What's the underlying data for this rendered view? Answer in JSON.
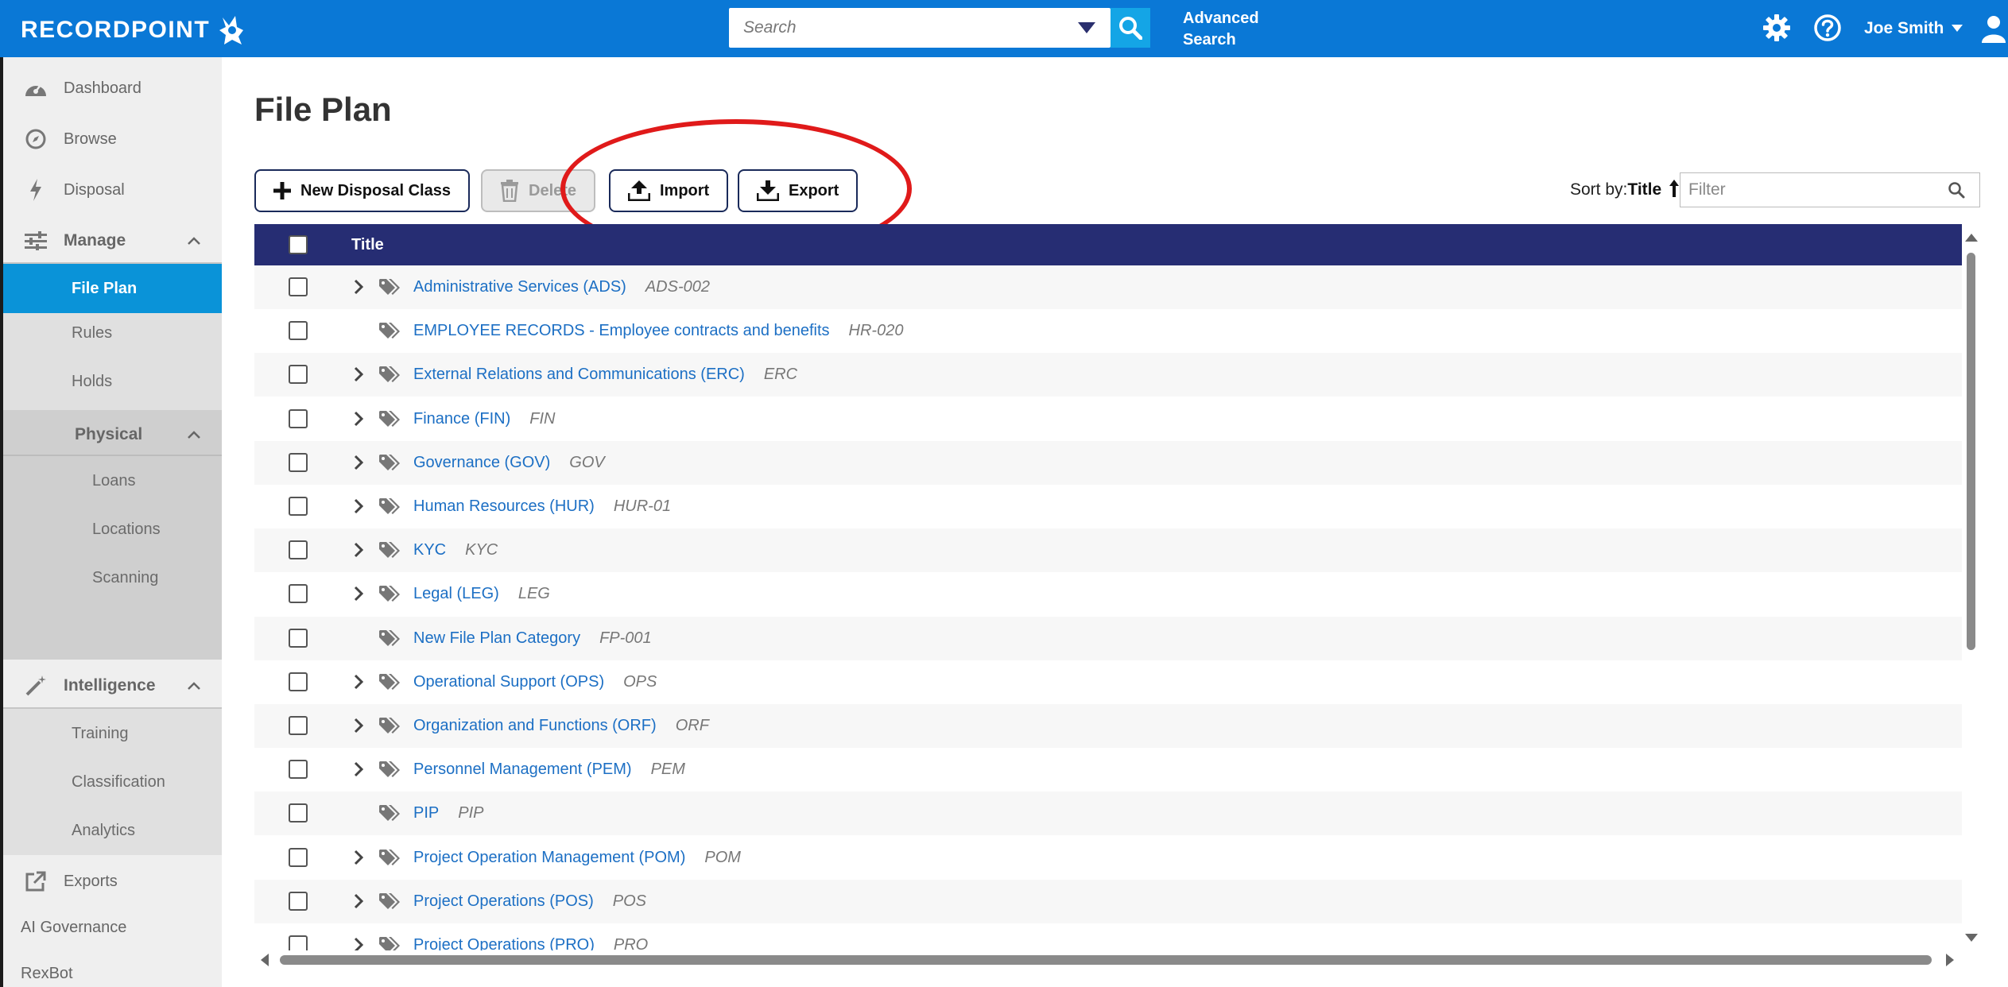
{
  "header": {
    "logo_text": "RECORDPOINT",
    "search_placeholder": "Search",
    "advanced_search_line1": "Advanced",
    "advanced_search_line2": "Search",
    "user_name": "Joe Smith",
    "bg_color": "#0a78d6"
  },
  "sidebar": {
    "dashboard": "Dashboard",
    "browse": "Browse",
    "disposal": "Disposal",
    "manage": "Manage",
    "file_plan": "File Plan",
    "rules": "Rules",
    "holds": "Holds",
    "physical": "Physical",
    "loans": "Loans",
    "locations": "Locations",
    "scanning": "Scanning",
    "intelligence": "Intelligence",
    "training": "Training",
    "classification": "Classification",
    "analytics": "Analytics",
    "exports": "Exports",
    "ai_governance": "AI Governance",
    "rexbot": "RexBot"
  },
  "main": {
    "title": "File Plan",
    "buttons": {
      "new_disposal_class": "New Disposal Class",
      "delete": "Delete",
      "import": "Import",
      "export": "Export"
    },
    "sort_label": "Sort by:",
    "sort_field": "Title",
    "filter_placeholder": "Filter",
    "table_header_title": "Title"
  },
  "rows": [
    {
      "name": "Administrative Services (ADS)",
      "code": "ADS-002",
      "expandable": true
    },
    {
      "name": "EMPLOYEE RECORDS - Employee contracts and benefits",
      "code": "HR-020",
      "expandable": false
    },
    {
      "name": "External Relations and Communications (ERC)",
      "code": "ERC",
      "expandable": true
    },
    {
      "name": "Finance (FIN)",
      "code": "FIN",
      "expandable": true
    },
    {
      "name": "Governance (GOV)",
      "code": "GOV",
      "expandable": true
    },
    {
      "name": "Human Resources (HUR)",
      "code": "HUR-01",
      "expandable": true
    },
    {
      "name": "KYC",
      "code": "KYC",
      "expandable": true
    },
    {
      "name": "Legal (LEG)",
      "code": "LEG",
      "expandable": true
    },
    {
      "name": "New File Plan Category",
      "code": "FP-001",
      "expandable": false
    },
    {
      "name": "Operational Support (OPS)",
      "code": "OPS",
      "expandable": true
    },
    {
      "name": "Organization and Functions (ORF)",
      "code": "ORF",
      "expandable": true
    },
    {
      "name": "Personnel Management (PEM)",
      "code": "PEM",
      "expandable": true
    },
    {
      "name": "PIP",
      "code": "PIP",
      "expandable": false
    },
    {
      "name": "Project Operation Management (POM)",
      "code": "POM",
      "expandable": true
    },
    {
      "name": "Project Operations (POS)",
      "code": "POS",
      "expandable": true
    },
    {
      "name": "Project Operations (PRO)",
      "code": "PRO",
      "expandable": true
    }
  ]
}
